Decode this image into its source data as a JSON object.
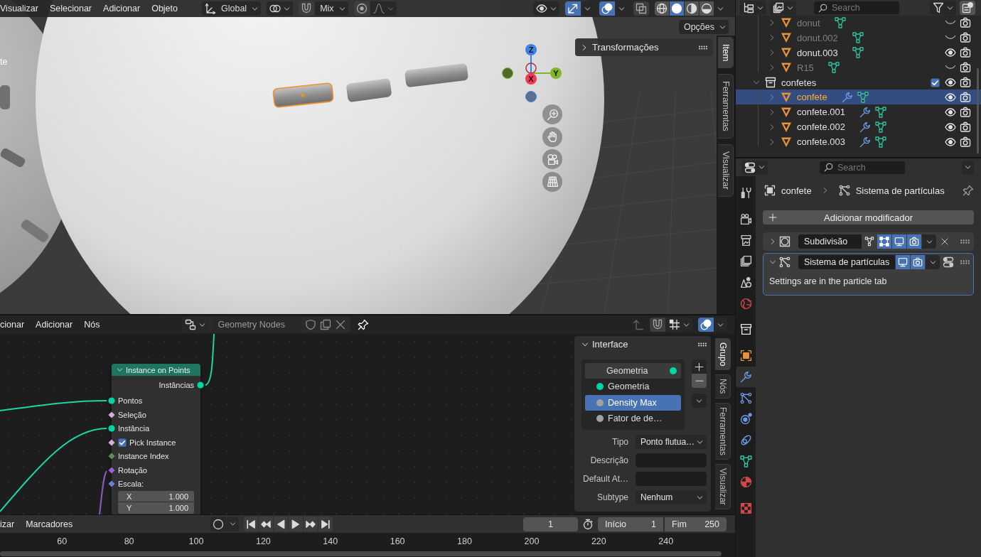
{
  "viewport": {
    "menus": [
      "Visualizar",
      "Selecionar",
      "Adicionar",
      "Objeto"
    ],
    "orientation": "Global",
    "snap": {
      "on": false,
      "target": "Mix"
    },
    "proportional": {
      "on": false
    },
    "toggles": [
      {
        "kind": "gizmo",
        "on": true
      },
      {
        "kind": "overlay",
        "on": true
      },
      {
        "kind": "xray",
        "on": false
      }
    ],
    "shading": [
      {
        "kind": "wireframe",
        "selected": false
      },
      {
        "kind": "solid",
        "selected": true
      },
      {
        "kind": "material",
        "selected": false
      },
      {
        "kind": "rendered",
        "selected": false
      }
    ],
    "options": "Opções",
    "info_text": "te",
    "axes": [
      {
        "label": "Z",
        "color": "#3b83e3"
      },
      {
        "label": "Y",
        "color": "#82b52a"
      },
      {
        "label": "X",
        "color": "#f23a52"
      }
    ],
    "panel": {
      "title": "Transformações",
      "expanded": false
    },
    "tabs": [
      {
        "label": "Item",
        "selected": true
      },
      {
        "label": "Ferramentas",
        "selected": false
      },
      {
        "label": "Visualizar",
        "selected": false
      }
    ]
  },
  "node_editor": {
    "menus": [
      "cionar",
      "Adicionar",
      "Nós"
    ],
    "node_group": "Geometry Nodes",
    "overlay": {
      "on": true
    },
    "node": {
      "title": "Instance on Points",
      "expanded": true,
      "outputs": [
        {
          "label": "Instâncias",
          "socket": {
            "kind": "circle",
            "color": "#00d6a3"
          }
        }
      ],
      "inputs": [
        {
          "kind": "socket",
          "label": "Pontos",
          "socket": {
            "kind": "circle",
            "color": "#00d6a3"
          }
        },
        {
          "kind": "socket",
          "label": "Seleção",
          "socket": {
            "kind": "diamond",
            "color": "#d4b0dc"
          }
        },
        {
          "kind": "socket",
          "label": "Instância",
          "socket": {
            "kind": "circle",
            "color": "#00d6a3"
          }
        },
        {
          "kind": "checkbox",
          "label": "Pick Instance",
          "checked": true,
          "socket": {
            "kind": "diamond",
            "color": "#d4b0dc"
          }
        },
        {
          "kind": "socket",
          "label": "Instance Index",
          "socket": {
            "kind": "diamond",
            "color": "#5e8c5e"
          }
        },
        {
          "kind": "socket",
          "label": "Rotação",
          "socket": {
            "kind": "diamond",
            "color": "#a35fd1"
          }
        },
        {
          "kind": "vector",
          "label": "Escala:",
          "socket": {
            "kind": "diamond",
            "color": "#6c7fd6"
          },
          "fields": [
            {
              "label": "X",
              "value": "1.000"
            },
            {
              "label": "Y",
              "value": "1.000"
            }
          ]
        }
      ]
    },
    "interface": {
      "title": "Interface",
      "expanded": true,
      "items": [
        {
          "kind": "output",
          "label": "Geometria",
          "color": "#00d6a3",
          "selected": false
        },
        {
          "kind": "input",
          "label": "Geometria",
          "color": "#00d6a3",
          "selected": false
        },
        {
          "kind": "input",
          "label": "Density Max",
          "color": "#a1a1a1",
          "selected": true
        },
        {
          "kind": "input",
          "label": "Fator de de…",
          "color": "#a1a1a1",
          "selected": false
        }
      ],
      "fields": [
        {
          "kind": "dropdown",
          "label": "Tipo",
          "value": "Ponto flutua…"
        },
        {
          "kind": "text",
          "label": "Descrição"
        },
        {
          "kind": "text",
          "label": "Default At…"
        },
        {
          "kind": "dropdown",
          "label": "Subtype",
          "value": "Nenhum"
        }
      ]
    },
    "tabs": [
      {
        "label": "Grupo",
        "selected": true
      },
      {
        "label": "Nós",
        "selected": false
      },
      {
        "label": "Ferramentas",
        "selected": false
      },
      {
        "label": "Visualizar",
        "selected": false
      }
    ]
  },
  "timeline": {
    "menus": [
      "izar",
      "Marcadores"
    ],
    "auto_keying": {
      "on": false
    },
    "current_frame": "1",
    "start": {
      "label": "Início",
      "value": "1"
    },
    "end": {
      "label": "Fim",
      "value": "250"
    },
    "ruler": [
      "60",
      "80",
      "100",
      "120",
      "140",
      "160",
      "180",
      "200",
      "220",
      "240"
    ]
  },
  "outliner": {
    "search": {
      "placeholder": "Search"
    },
    "tree": [
      {
        "kind": "scrolled",
        "children": [
          {
            "kind": "object",
            "name": "donut",
            "expanded": false,
            "selected": false,
            "visible": false,
            "modifier": false
          },
          {
            "kind": "object",
            "name": "donut.002",
            "expanded": false,
            "selected": false,
            "visible": false,
            "modifier": false
          },
          {
            "kind": "object",
            "name": "donut.003",
            "expanded": false,
            "selected": false,
            "visible": true,
            "modifier": false
          },
          {
            "kind": "object",
            "name": "R15",
            "expanded": false,
            "selected": false,
            "visible": false,
            "modifier": false
          }
        ]
      },
      {
        "kind": "collection",
        "name": "confetes",
        "expanded": true,
        "selected": false,
        "visible": true,
        "checked": true,
        "children": [
          {
            "kind": "object",
            "name": "confete",
            "expanded": false,
            "selected": true,
            "visible": true,
            "modifier": true
          },
          {
            "kind": "object",
            "name": "confete.001",
            "expanded": false,
            "selected": false,
            "visible": true,
            "modifier": true
          },
          {
            "kind": "object",
            "name": "confete.002",
            "expanded": false,
            "selected": false,
            "visible": true,
            "modifier": true
          },
          {
            "kind": "object",
            "name": "confete.003",
            "expanded": false,
            "selected": false,
            "visible": true,
            "modifier": true
          }
        ]
      }
    ]
  },
  "properties": {
    "search": {
      "placeholder": "Search"
    },
    "tabs": [
      {
        "kind": "tool",
        "selected": false
      },
      {
        "kind": "render",
        "selected": false
      },
      {
        "kind": "output",
        "selected": false
      },
      {
        "kind": "viewlayer",
        "selected": false
      },
      {
        "kind": "scene",
        "selected": false
      },
      {
        "kind": "world",
        "selected": false
      },
      {
        "kind": "collection",
        "selected": false
      },
      {
        "kind": "object",
        "selected": false
      },
      {
        "kind": "modifiers",
        "selected": true
      },
      {
        "kind": "particles",
        "selected": false
      },
      {
        "kind": "physics",
        "selected": false
      },
      {
        "kind": "constraints",
        "selected": false
      },
      {
        "kind": "data",
        "selected": false
      },
      {
        "kind": "material",
        "selected": false
      },
      {
        "kind": "texture",
        "selected": false
      }
    ],
    "breadcrumb": [
      {
        "kind": "object",
        "label": "confete"
      },
      {
        "kind": "particles",
        "label": "Sistema de partículas"
      }
    ],
    "add_modifier": "Adicionar modificador",
    "modifiers": [
      {
        "kind": "subdivision",
        "name": "Subdivisão",
        "expanded": false,
        "active": false,
        "toggles": [
          {
            "kind": "editmode",
            "on": false
          },
          {
            "kind": "cage",
            "on": true
          },
          {
            "kind": "viewport",
            "on": true
          },
          {
            "kind": "render",
            "on": true
          }
        ]
      },
      {
        "kind": "particles",
        "name": "Sistema de partículas",
        "expanded": true,
        "active": true,
        "toggles": [
          {
            "kind": "viewport",
            "on": true
          },
          {
            "kind": "render",
            "on": true
          }
        ],
        "note": "Settings are in the particle tab"
      }
    ]
  }
}
